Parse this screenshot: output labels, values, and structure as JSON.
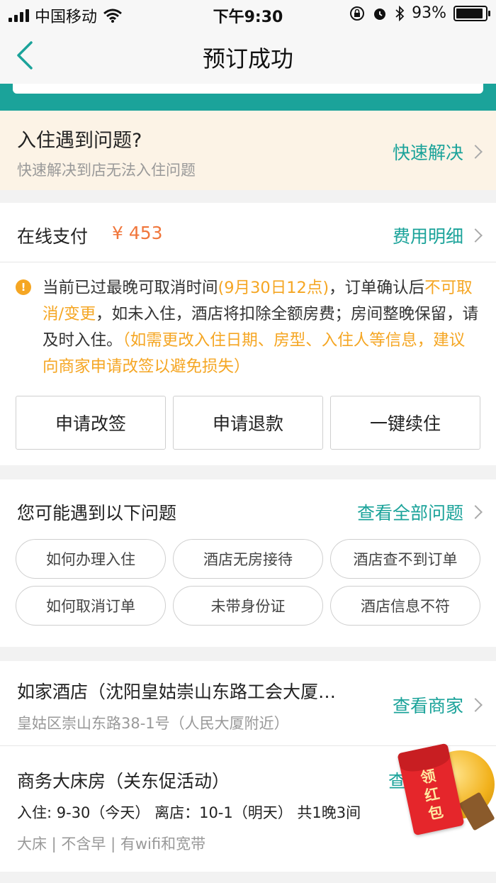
{
  "status_bar": {
    "carrier": "中国移动",
    "time": "下午9:30",
    "battery": "93%",
    "battery_level": 0.93,
    "icons": [
      "signal-icon",
      "wifi-icon",
      "rotation-lock-icon",
      "alarm-icon",
      "bluetooth-icon",
      "battery-icon"
    ]
  },
  "nav": {
    "title": "预订成功",
    "back_icon": "back-chevron-icon"
  },
  "notice": {
    "title": "入住遇到问题?",
    "subtitle": "快速解决到店无法入住问题",
    "link": "快速解决"
  },
  "payment": {
    "label": "在线支付",
    "amount": "¥ 453",
    "link": "费用明细",
    "policy": {
      "p1": "当前已过最晚可取消时间",
      "p2": "(9月30日12点)",
      "p3": "，订单确认后",
      "p4": "不可取消/变更",
      "p5": "，如未入住，酒店将扣除全额房费；房间整晚保留，请及时入住。",
      "p6": "（如需更改入住日期、房型、入住人等信息，建议向商家申请改签以避免损失）"
    },
    "buttons": [
      "申请改签",
      "申请退款",
      "一键续住"
    ]
  },
  "issues": {
    "title": "您可能遇到以下问题",
    "link": "查看全部问题",
    "items": [
      "如何办理入住",
      "酒店无房接待",
      "酒店查不到订单",
      "如何取消订单",
      "未带身份证",
      "酒店信息不符"
    ]
  },
  "hotel": {
    "name": "如家酒店（沈阳皇姑崇山东路工会大厦…",
    "address": "皇姑区崇山东路38-1号（人民大厦附近）",
    "link": "查看商家"
  },
  "room": {
    "name": "商务大床房（关东促活动）",
    "dates": "入住: 9-30（今天） 离店：10-1（明天） 共1晚3间",
    "tags": "大床 | 不含早 | 有wifi和宽带",
    "link_peek": "查"
  },
  "red_packet": {
    "line1": "领",
    "line2": "红",
    "line3": "包"
  },
  "colors": {
    "accent": "#1ba39a",
    "price": "#f0763b",
    "warning": "#f5a623",
    "notice_bg": "#fcf3e6"
  }
}
